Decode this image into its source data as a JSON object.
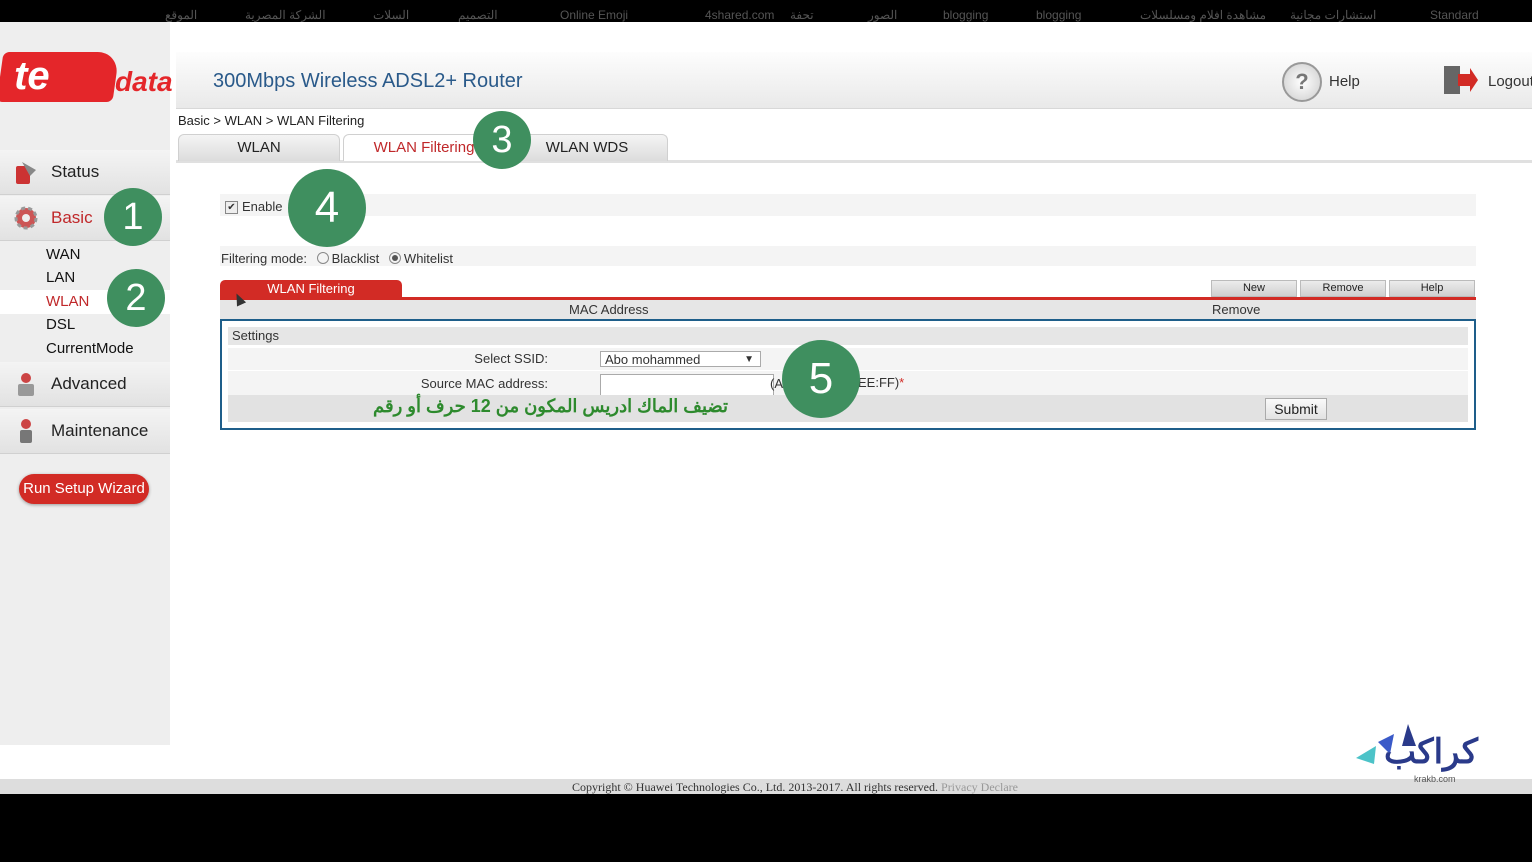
{
  "bookmarks": [
    "الموقع",
    "الشركة المصرية",
    "السلات",
    "التصميم",
    "Online Emoji",
    "4shared.com",
    "تحفة",
    "الصور",
    "blogging",
    "blogging",
    "مشاهدة افلام ومسلسلات",
    "استشارات مجانية",
    "Standard"
  ],
  "header": {
    "title": "300Mbps Wireless ADSL2+ Router",
    "help_label": "Help",
    "logout_label": "Logout"
  },
  "logo": {
    "te": "te",
    "data": "data"
  },
  "sidebar": {
    "items": [
      {
        "label": "Status"
      },
      {
        "label": "Basic"
      },
      {
        "label": "Advanced"
      },
      {
        "label": "Maintenance"
      }
    ],
    "sub_items": [
      "WAN",
      "LAN",
      "WLAN",
      "DSL",
      "CurrentMode"
    ],
    "wizard_label": "Run Setup Wizard"
  },
  "breadcrumb": "Basic > WLAN > WLAN Filtering",
  "tabs": [
    {
      "label": "WLAN"
    },
    {
      "label": "WLAN Filtering"
    },
    {
      "label": "WLAN WDS"
    }
  ],
  "enable": {
    "label": "Enable",
    "checked": true
  },
  "filtering_mode": {
    "label": "Filtering mode:",
    "options": [
      "Blacklist",
      "Whitelist"
    ],
    "selected": "Whitelist"
  },
  "table": {
    "tab_label": "WLAN Filtering",
    "buttons": [
      "New",
      "Remove",
      "Help"
    ],
    "columns": [
      "MAC Address",
      "Remove"
    ]
  },
  "settings": {
    "title": "Settings",
    "ssid_label": "Select SSID:",
    "ssid_value": "Abo mohammed",
    "mac_label": "Source MAC address:",
    "mac_value": "",
    "mac_hint_left": "(A",
    "mac_hint_right": "EE:FF)",
    "required_mark": "*",
    "submit_label": "Submit"
  },
  "annotation_text": "تضيف الماك ادريس المكون من 12 حرف أو رقم",
  "step_numbers": [
    "1",
    "2",
    "3",
    "4",
    "5"
  ],
  "footer": {
    "copyright": "Copyright © Huawei Technologies Co., Ltd. 2013-2017. All rights reserved.",
    "privacy": "Privacy Declare"
  },
  "watermark": {
    "text": "كراكب",
    "sub": "krakb.com"
  },
  "colors": {
    "accent_red": "#d22b25",
    "step_green": "#3f8f5f",
    "title_blue": "#2a5a8a",
    "box_border": "#1e5e8a"
  }
}
